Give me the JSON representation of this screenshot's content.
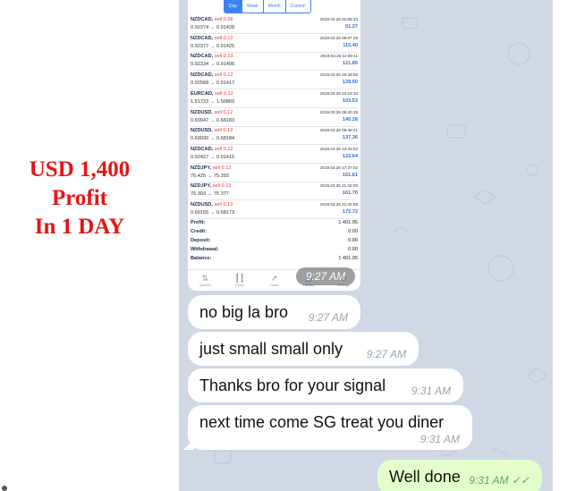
{
  "headline": {
    "line1": "USD 1,400",
    "line2": "Profit",
    "line3": "In  1 DAY"
  },
  "colors": {
    "headline": "#e31515",
    "chat_bg": "#cfd8e4",
    "incoming_bubble": "#ffffff",
    "outgoing_bubble": "#e3fecb",
    "profit_blue": "#2a6fd6",
    "sell_red": "#e53935"
  },
  "screenshot": {
    "tabs": [
      "Day",
      "Week",
      "Month",
      "Custom"
    ],
    "active_tab": "Day",
    "trades": [
      {
        "symbol": "NZDCAD,",
        "side": "sell 0.06",
        "time": "2019.03.25 02:08:33",
        "price": "0.92274 → 0.91428",
        "profit": "51.27"
      },
      {
        "symbol": "NZDCAD,",
        "side": "sell 0.12",
        "time": "2019.03.25 09:07:29",
        "price": "0.92377 → 0.91425",
        "profit": "115.40"
      },
      {
        "symbol": "NZDCAD,",
        "side": "sell 0.13",
        "time": "2019.03.25 12:00:11",
        "price": "0.92334 → 0.91406",
        "profit": "121.85"
      },
      {
        "symbol": "NZDCAD,",
        "side": "sell 0.12",
        "time": "2019.03.25 16:36:55",
        "price": "0.92568 → 0.91417",
        "profit": "139.50"
      },
      {
        "symbol": "EURCAD,",
        "side": "sell 0.12",
        "time": "2019.03.25 22:19:10",
        "price": "1.51723 → 1.50869",
        "profit": "103.53"
      },
      {
        "symbol": "NZDUSD,",
        "side": "sell 0.12",
        "time": "2019.03.25 08:40:49",
        "price": "0.69047 → 0.68183",
        "profit": "140.28"
      },
      {
        "symbol": "NZDUSD,",
        "side": "sell 0.12",
        "time": "2019.03.26 08:48:21",
        "price": "0.69030 → 0.68184",
        "profit": "137.36"
      },
      {
        "symbol": "NZDCAD,",
        "side": "sell 0.12",
        "time": "2019.03.26 13:33:02",
        "price": "0.92427 → 0.91415",
        "profit": "122.64"
      },
      {
        "symbol": "NZDJPY,",
        "side": "sell 0.12",
        "time": "2019.03.26 17:37:02",
        "price": "76.425 → 75.393",
        "profit": "151.61"
      },
      {
        "symbol": "NZDJPY,",
        "side": "sell 0.13",
        "time": "2019.03.26 21:42:00",
        "price": "76.393 → 75.377",
        "profit": "161.70"
      },
      {
        "symbol": "NZDUSD,",
        "side": "sell 0.13",
        "time": "2019.03.26 21:42:59",
        "price": "0.69155 → 0.68173",
        "profit": "172.72"
      }
    ],
    "summary": [
      {
        "label": "Profit:",
        "value": "1 401.95"
      },
      {
        "label": "Credit:",
        "value": "0.00"
      },
      {
        "label": "Deposit:",
        "value": "0.00"
      },
      {
        "label": "Withdrawal:",
        "value": "0.00"
      },
      {
        "label": "Balance:",
        "value": "1 401.95"
      }
    ],
    "nav": [
      {
        "label": "Quotes",
        "icon": "quotes-icon"
      },
      {
        "label": "Chart",
        "icon": "chart-icon"
      },
      {
        "label": "Trade",
        "icon": "trade-icon"
      },
      {
        "label": "History",
        "icon": "history-icon"
      },
      {
        "label": "Settings",
        "icon": "settings-icon"
      }
    ],
    "active_nav": "History",
    "image_time": "9:27 AM"
  },
  "messages": [
    {
      "direction": "incoming",
      "text": "no big la bro",
      "time": "9:27 AM"
    },
    {
      "direction": "incoming",
      "text": "just small small only",
      "time": "9:27 AM"
    },
    {
      "direction": "incoming",
      "text": "Thanks bro for your signal",
      "time": "9:31 AM"
    },
    {
      "direction": "incoming",
      "text": "next time come SG treat you diner",
      "time": "9:31 AM"
    },
    {
      "direction": "outgoing",
      "text": "Well done",
      "time": "9:31 AM",
      "status": "read-double-check-icon"
    }
  ]
}
